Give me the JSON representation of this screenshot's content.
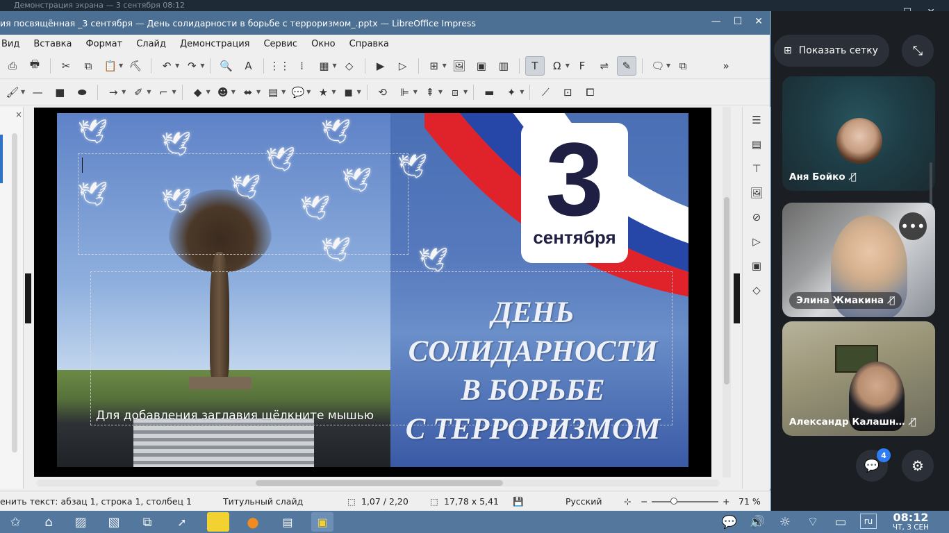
{
  "top_strip": {
    "ghost_title": "Демонстрация экрана — 3 сентября 08:12"
  },
  "lo_window": {
    "title": "ия посвящённая _3 сентября — День солидарности в борьбе с терроризмом_.pptx — LibreOffice Impress",
    "controls": {
      "minimize": "—",
      "maximize": "☐",
      "close": "✕"
    },
    "menu": [
      "Вид",
      "Вставка",
      "Формат",
      "Слайд",
      "Демонстрация",
      "Сервис",
      "Окно",
      "Справка"
    ],
    "panel_close": "×"
  },
  "slide": {
    "date_number": "3",
    "date_month": "сентября",
    "title_lines": [
      "ДЕНЬ",
      "СОЛИДАРНОСТИ",
      "В БОРЬБЕ",
      "С ТЕРРОРИЗМОМ"
    ],
    "placeholder": "Для добавления заглавия щёлкните мышью"
  },
  "status_bar": {
    "edit_text": "енить текст: абзац 1, строка 1, столбец 1",
    "layout": "Титульный слайд",
    "position": "1,07 / 2,20",
    "size": "17,78 x 5,41",
    "language": "Русский",
    "zoom_minus": "−",
    "zoom_plus": "+",
    "zoom": "71 %",
    "zoom_level_percent": 71
  },
  "video_call": {
    "grid_button": "Показать сетку",
    "participants": [
      {
        "name": "Аня Бойко",
        "muted": true
      },
      {
        "name": "Элина Жмакина",
        "muted": true
      },
      {
        "name": "Александр Калашн…",
        "muted": true
      }
    ],
    "more_icon": "•••",
    "chat_badge": "4"
  },
  "taskbar": {
    "lang": "ru",
    "time": "08:12",
    "date": "ЧТ, 3 СЕН"
  },
  "colors": {
    "title_bar": "#4c6f94",
    "taskbar": "#54779e",
    "call_panel": "#1b1f24",
    "chat_badge": "#2d7df6"
  }
}
